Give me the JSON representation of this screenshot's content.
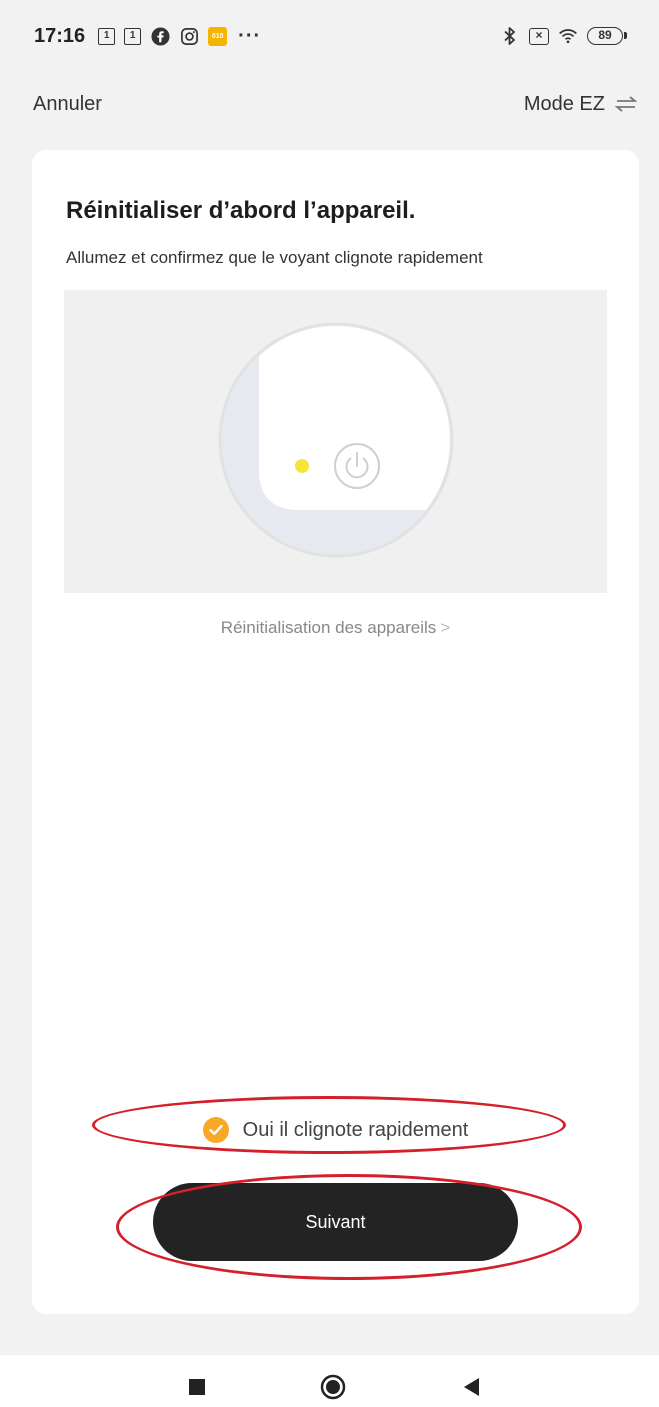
{
  "status_bar": {
    "time": "17:16",
    "cal1": "1",
    "cal2": "1",
    "app_badge": "010",
    "more": "···",
    "x_box": "×",
    "battery": "89",
    "icons": [
      "calendar-icon",
      "calendar-icon",
      "facebook-icon",
      "instagram-icon",
      "app-icon",
      "bluetooth-icon",
      "sim-off-icon",
      "wifi-icon",
      "battery-icon"
    ]
  },
  "header": {
    "cancel_label": "Annuler",
    "mode_label": "Mode EZ",
    "mode_icon": "switch-arrows-icon"
  },
  "card": {
    "title": "Réinitialiser d’abord l’appareil.",
    "subtitle": "Allumez et confirmez que le voyant clignote rapidement",
    "illustration": {
      "indicator_color": "#f5e43a",
      "icon": "power-icon"
    },
    "reset_link": "Réinitialisation des appareils",
    "reset_chevron": ">",
    "confirm_label": "Oui il clignote rapidement",
    "confirm_checked": true,
    "next_label": "Suivant"
  },
  "colors": {
    "accent": "#f7a826",
    "button": "#232323",
    "annotation": "#d4202a",
    "background": "#f2f2f2"
  },
  "system_nav": {
    "icons": [
      "recent-apps-icon",
      "home-icon",
      "back-icon"
    ]
  }
}
